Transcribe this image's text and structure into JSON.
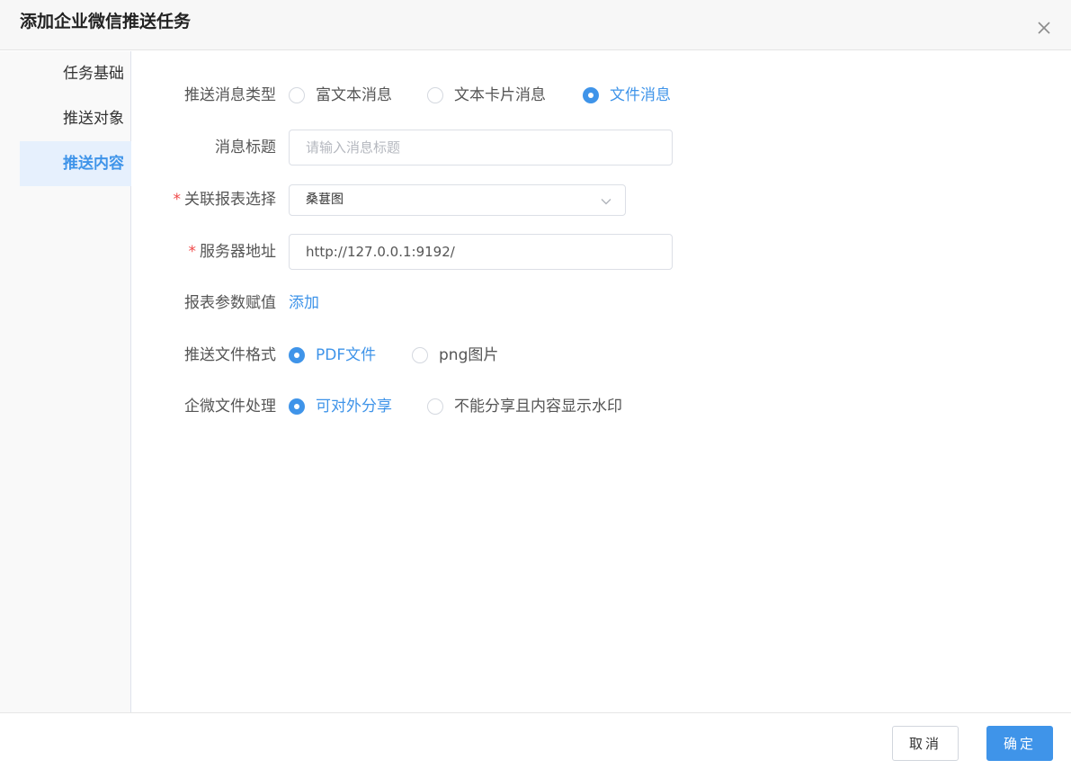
{
  "dialog": {
    "title": "添加企业微信推送任务",
    "close_icon": "close-icon"
  },
  "sidebar": {
    "items": [
      {
        "label": "任务基础",
        "active": false
      },
      {
        "label": "推送对象",
        "active": false
      },
      {
        "label": "推送内容",
        "active": true
      }
    ]
  },
  "form": {
    "message_type": {
      "label": "推送消息类型",
      "options": [
        {
          "label": "富文本消息",
          "checked": false
        },
        {
          "label": "文本卡片消息",
          "checked": false
        },
        {
          "label": "文件消息",
          "checked": true
        }
      ]
    },
    "message_title": {
      "label": "消息标题",
      "value": "",
      "placeholder": "请输入消息标题"
    },
    "report_select": {
      "label": "关联报表选择",
      "required_mark": "*",
      "value": "桑葚图",
      "chevron_icon": "chevron-down-icon"
    },
    "server_address": {
      "label": "服务器地址",
      "required_mark": "*",
      "value": "http://127.0.0.1:9192/"
    },
    "report_params": {
      "label": "报表参数赋值",
      "add_link": "添加"
    },
    "file_format": {
      "label": "推送文件格式",
      "options": [
        {
          "label": "PDF文件",
          "checked": true
        },
        {
          "label": "png图片",
          "checked": false
        }
      ]
    },
    "file_handling": {
      "label": "企微文件处理",
      "options": [
        {
          "label": "可对外分享",
          "checked": true
        },
        {
          "label": "不能分享且内容显示水印",
          "checked": false
        }
      ]
    }
  },
  "footer": {
    "cancel_label": "取消",
    "ok_label": "确定"
  },
  "colors": {
    "accent": "#3f94e9",
    "required": "#f04848",
    "active_bg": "#e6f0fd"
  }
}
